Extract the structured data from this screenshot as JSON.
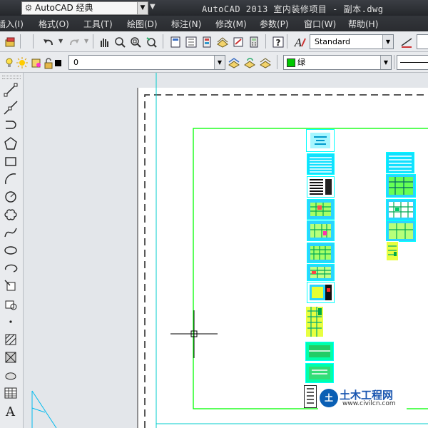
{
  "titlebar": {
    "workspace": "AutoCAD 经典",
    "app_title": "AutoCAD 2013    室内装修项目 - 副本.dwg"
  },
  "menu": {
    "items": [
      "插入(I)",
      "格式(O)",
      "工具(T)",
      "绘图(D)",
      "标注(N)",
      "修改(M)",
      "参数(P)",
      "窗口(W)",
      "帮助(H)"
    ]
  },
  "toolbar1": {
    "text_style": "Standard"
  },
  "toolbar2": {
    "layer_name": "0",
    "layer_color_hex": "#000000",
    "color_name": "绿",
    "color_hex": "#00c800"
  },
  "left_tools": [
    "line-icon",
    "construction-line-icon",
    "polyline-icon",
    "polygon-icon",
    "rectangle-icon",
    "arc-icon",
    "circle-icon",
    "revision-cloud-icon",
    "spline-icon",
    "ellipse-icon",
    "ellipse-arc-icon",
    "insert-block-icon",
    "make-block-icon",
    "point-icon",
    "hatch-icon",
    "gradient-icon",
    "region-icon",
    "table-icon",
    "multiline-text-icon"
  ],
  "watermark": {
    "mark": "土",
    "name": "土木工程网",
    "url": "www.civilcn.com"
  },
  "colors": {
    "thumbnail_border": "#00ffff",
    "frame_green": "#00ff00",
    "crosshair": "#000000"
  }
}
